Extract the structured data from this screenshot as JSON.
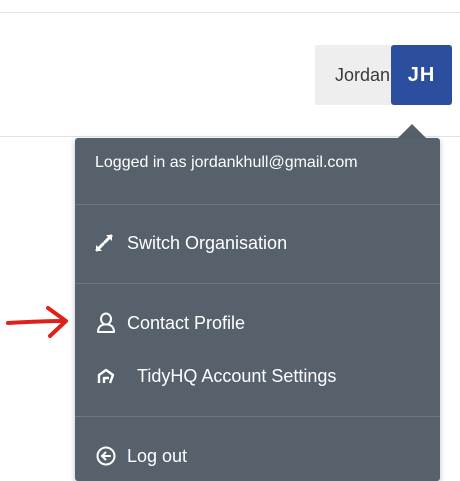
{
  "user": {
    "name": "Jordan",
    "initials": "JH"
  },
  "menu": {
    "logged_in_text": "Logged in as jordankhull@gmail.com",
    "items": [
      {
        "label": "Switch Organisation",
        "icon": "expand-arrows-icon"
      },
      {
        "label": "Contact Profile",
        "icon": "user-icon"
      },
      {
        "label": "TidyHQ Account Settings",
        "icon": "tidyhq-logo-icon"
      },
      {
        "label": "Log out",
        "icon": "circle-arrow-left-icon"
      }
    ]
  },
  "colors": {
    "menu_bg": "#56616b",
    "avatar_bg": "#2b4f9e",
    "annotation_arrow": "#e0201b"
  }
}
